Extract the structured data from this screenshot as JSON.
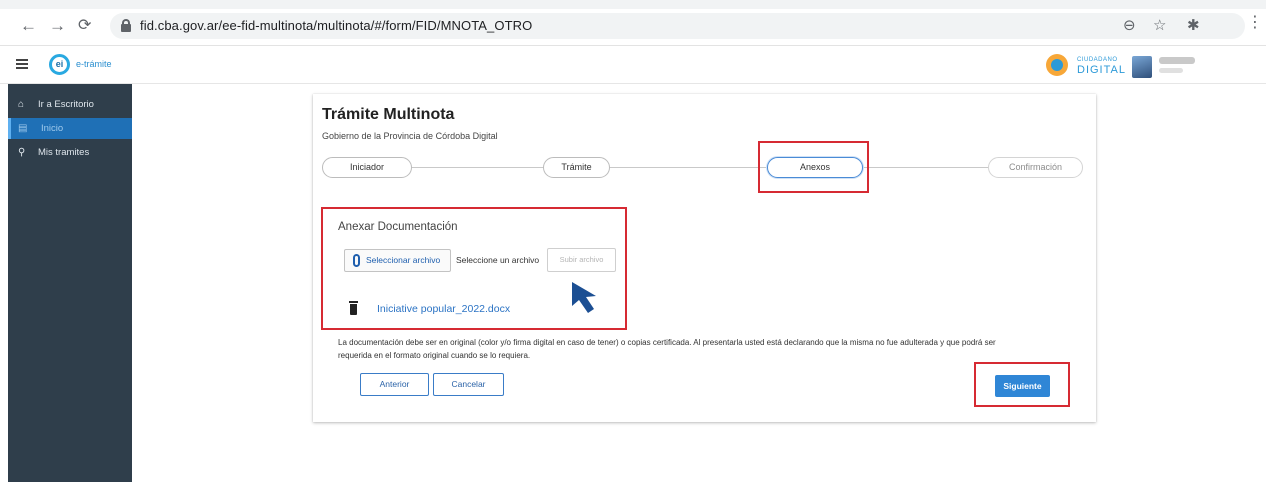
{
  "browser": {
    "back_glyph": "←",
    "forward_glyph": "→",
    "reload_glyph": "⟳",
    "url": "fid.cba.gov.ar/ee-fid-multinota/multinota/#/form/FID/MNOTA_OTRO",
    "zoom_glyph": "⊖",
    "star_glyph": "☆",
    "extensions_glyph": "✱",
    "menu_glyph": "⋮"
  },
  "header": {
    "logo_mark": "ei",
    "brand": "e-trámite",
    "partner_logo_top": "CIUDADANO",
    "partner_logo_bottom": "DIGITAL"
  },
  "sidebar": {
    "items": [
      {
        "icon": "home-icon",
        "glyph": "⌂",
        "label": "Ir a Escritorio"
      },
      {
        "icon": "document-icon",
        "glyph": "▤",
        "label": "Inicio"
      },
      {
        "icon": "search-icon",
        "glyph": "⚲",
        "label": "Mis tramites"
      }
    ]
  },
  "form": {
    "title": "Trámite Multinota",
    "subtitle": "Gobierno de la Provincia de Córdoba Digital",
    "steps": [
      {
        "label": "Iniciador",
        "state": "done"
      },
      {
        "label": "Trámite",
        "state": "done"
      },
      {
        "label": "Anexos",
        "state": "active"
      },
      {
        "label": "Confirmación",
        "state": "disabled"
      }
    ],
    "attachments": {
      "section_title": "Anexar Documentación",
      "select_button": "Seleccionar archivo",
      "select_hint": "Seleccione un archivo",
      "upload_button": "Subir archivo",
      "file_name": "Iniciative popular_2022.docx"
    },
    "notice_line1": "La documentación debe ser en original (color y/o firma digital en caso de tener) o copias certificada. Al presentarla usted está declarando que la misma no fue adulterada y que podrá ser",
    "notice_line2": "requerida en el formato original cuando se lo requiera.",
    "buttons": {
      "back": "Anterior",
      "cancel": "Cancelar",
      "next": "Siguiente"
    }
  },
  "colors": {
    "sidebar_bg": "#2f3e4b",
    "sidebar_active": "#1f70b6",
    "highlight_red": "#d62a33",
    "primary_blue": "#2f86d6",
    "cursor_blue": "#1c4f93"
  }
}
